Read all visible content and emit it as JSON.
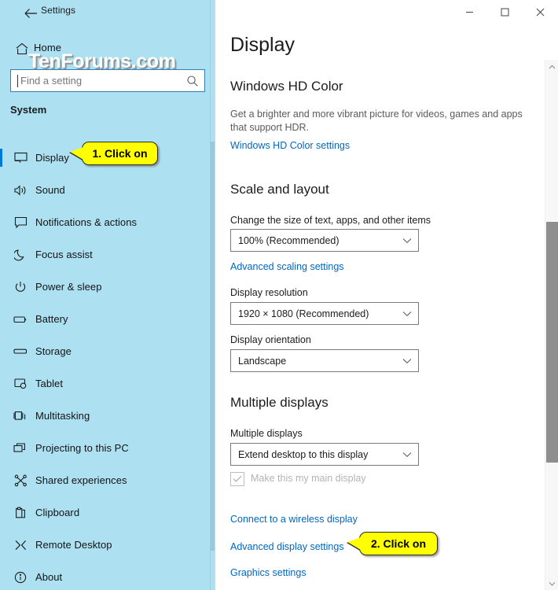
{
  "window": {
    "back_label": "←",
    "title": "Settings",
    "controls": {
      "minimize": "–",
      "maximize": "☐",
      "close": "✕"
    }
  },
  "watermark": "TenForums.com",
  "sidebar": {
    "home_label": "Home",
    "home_icon": "home-icon",
    "search": {
      "placeholder": "Find a setting",
      "value": "",
      "icon": "search-icon"
    },
    "group_heading": "System",
    "items": [
      {
        "label": "Display",
        "icon": "monitor-icon",
        "selected": true
      },
      {
        "label": "Sound",
        "icon": "speaker-icon",
        "selected": false
      },
      {
        "label": "Notifications & actions",
        "icon": "notification-icon",
        "selected": false
      },
      {
        "label": "Focus assist",
        "icon": "moon-icon",
        "selected": false
      },
      {
        "label": "Power & sleep",
        "icon": "power-icon",
        "selected": false
      },
      {
        "label": "Battery",
        "icon": "battery-icon",
        "selected": false
      },
      {
        "label": "Storage",
        "icon": "storage-icon",
        "selected": false
      },
      {
        "label": "Tablet",
        "icon": "tablet-icon",
        "selected": false
      },
      {
        "label": "Multitasking",
        "icon": "multitasking-icon",
        "selected": false
      },
      {
        "label": "Projecting to this PC",
        "icon": "projecting-icon",
        "selected": false
      },
      {
        "label": "Shared experiences",
        "icon": "shared-experiences-icon",
        "selected": false
      },
      {
        "label": "Clipboard",
        "icon": "clipboard-icon",
        "selected": false
      },
      {
        "label": "Remote Desktop",
        "icon": "remote-desktop-icon",
        "selected": false
      },
      {
        "label": "About",
        "icon": "info-icon",
        "selected": false
      }
    ]
  },
  "main": {
    "page_title": "Display",
    "hd_color": {
      "heading": "Windows HD Color",
      "description": "Get a brighter and more vibrant picture for videos, games and apps that support HDR.",
      "link": "Windows HD Color settings"
    },
    "scale_layout": {
      "heading": "Scale and layout",
      "scale_label": "Change the size of text, apps, and other items",
      "scale_value": "100% (Recommended)",
      "advanced_scaling_link": "Advanced scaling settings",
      "resolution_label": "Display resolution",
      "resolution_value": "1920 × 1080 (Recommended)",
      "orientation_label": "Display orientation",
      "orientation_value": "Landscape"
    },
    "multiple_displays": {
      "heading": "Multiple displays",
      "field_label": "Multiple displays",
      "field_value": "Extend desktop to this display",
      "main_display_checkbox_label": "Make this my main display",
      "main_display_checked": true,
      "wireless_link": "Connect to a wireless display",
      "advanced_display_link": "Advanced display settings",
      "graphics_link": "Graphics settings"
    }
  },
  "callouts": [
    {
      "text": "1. Click on"
    },
    {
      "text": "2. Click on"
    }
  ],
  "colors": {
    "sidebar_bg": "#ade1f2",
    "accent": "#0078d7",
    "link": "#0067c0",
    "callout_bg": "#ffff00"
  }
}
